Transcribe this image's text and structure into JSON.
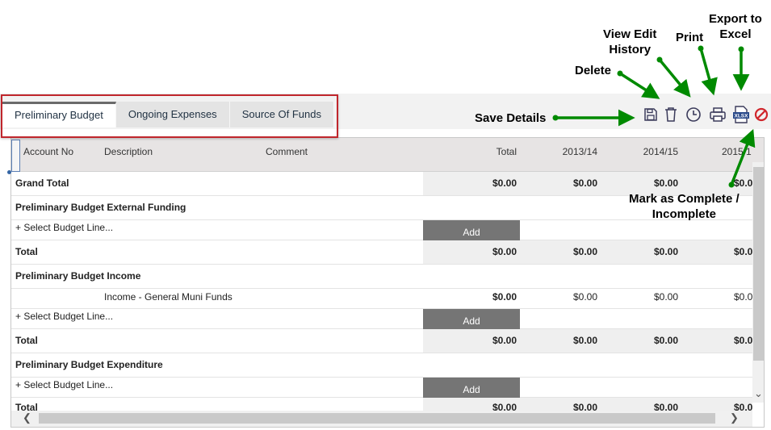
{
  "annotations": {
    "export_to_excel": "Export to\nExcel",
    "view_edit_history": "View Edit\nHistory",
    "print": "Print",
    "delete": "Delete",
    "save_details": "Save Details",
    "mark_complete": "Mark as Complete /\nIncomplete",
    "arrow_color": "#008a00"
  },
  "tabs": [
    {
      "label": "Preliminary Budget",
      "active": true
    },
    {
      "label": "Ongoing Expenses",
      "active": false
    },
    {
      "label": "Source Of Funds",
      "active": false
    }
  ],
  "toolbar": {
    "icons": [
      "save-icon",
      "delete-icon",
      "history-icon",
      "print-icon",
      "export-xlsx-icon",
      "mark-complete-icon"
    ],
    "xlsx_text": "XLSX",
    "icon_color": "#3a3a5a",
    "complete_color": "#d0262c"
  },
  "grid": {
    "columns": {
      "account_no": "Account No",
      "description": "Description",
      "comment": "Comment",
      "total": "Total",
      "y1": "2013/14",
      "y2": "2014/15",
      "y3": "2015/1"
    },
    "grand_total": {
      "label": "Grand Total",
      "total": "$0.00",
      "y1": "$0.00",
      "y2": "$0.00",
      "y3": "$0.0"
    },
    "external_funding": {
      "title": "Preliminary Budget External Funding",
      "select": "+ Select Budget Line...",
      "add": "Add",
      "total_label": "Total",
      "total": "$0.00",
      "y1": "$0.00",
      "y2": "$0.00",
      "y3": "$0.0"
    },
    "income": {
      "title": "Preliminary Budget Income",
      "line_description": "Income - General Muni Funds",
      "line_total": "$0.00",
      "line_y1": "$0.00",
      "line_y2": "$0.00",
      "line_y3": "$0.0",
      "select": "+ Select Budget Line...",
      "add": "Add",
      "total_label": "Total",
      "total": "$0.00",
      "y1": "$0.00",
      "y2": "$0.00",
      "y3": "$0.0"
    },
    "expenditure": {
      "title": "Preliminary Budget Expenditure",
      "select": "+ Select Budget Line...",
      "add": "Add",
      "total_label": "Total",
      "total": "$0.00",
      "y1": "$0.00",
      "y2": "$0.00",
      "y3": "$0.0"
    }
  }
}
